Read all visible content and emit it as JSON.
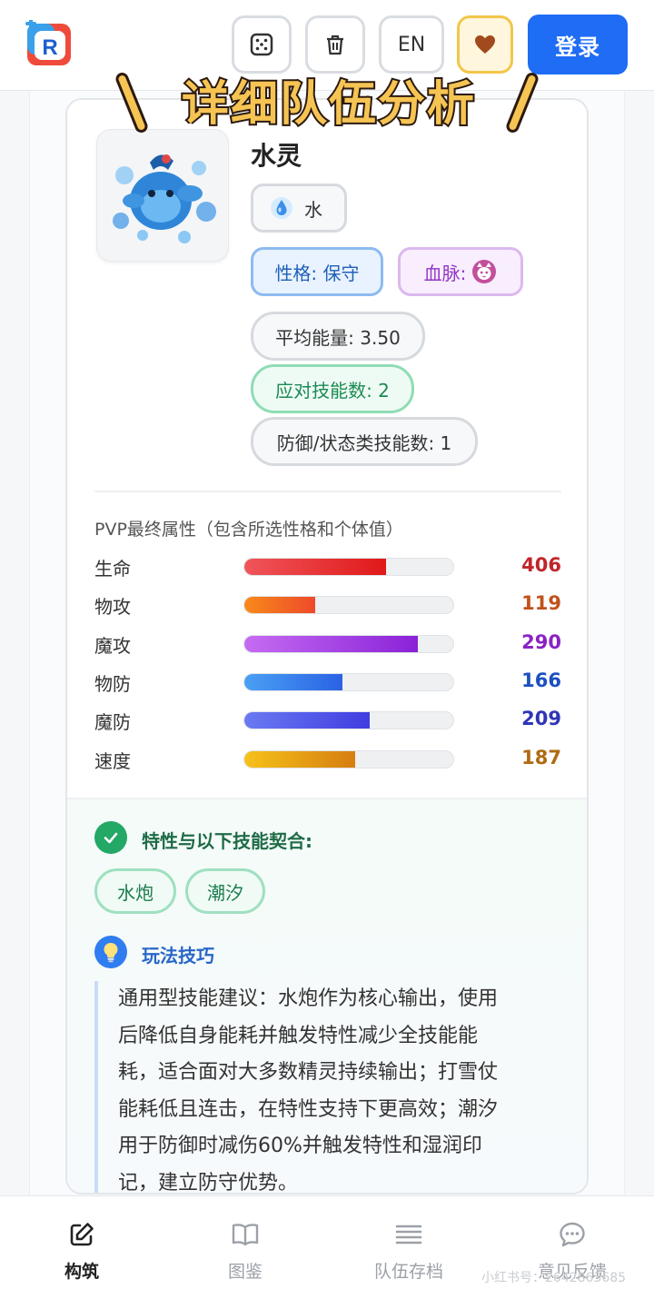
{
  "header": {
    "lang_label": "EN",
    "login_label": "登录",
    "icons": [
      "dice-icon",
      "trash-icon",
      "heart-icon"
    ]
  },
  "overlay": {
    "title": "详细队伍分析"
  },
  "pet": {
    "name": "水灵",
    "type_label": "水",
    "nature_label": "性格: 保守",
    "bloodline_label": "血脉:",
    "avg_energy": "平均能量: 3.50",
    "counter_skills": "应对技能数: 2",
    "defense_skills": "防御/状态类技能数: 1"
  },
  "stats": {
    "title": "PVP最终属性（包含所选性格和个体值）",
    "max_value": 430,
    "rows": [
      {
        "label": "生命",
        "value": "406",
        "fraction": 0.68,
        "color": "#c0262b",
        "grad": [
          "#f0555a",
          "#e01919"
        ]
      },
      {
        "label": "物攻",
        "value": "119",
        "fraction": 0.34,
        "color": "#c0521c",
        "grad": [
          "#f88a1a",
          "#ee4a2a"
        ]
      },
      {
        "label": "魔攻",
        "value": "290",
        "fraction": 0.83,
        "color": "#8a22c4",
        "grad": [
          "#c56cf2",
          "#8a22d8"
        ]
      },
      {
        "label": "物防",
        "value": "166",
        "fraction": 0.47,
        "color": "#1d4fc0",
        "grad": [
          "#4aa0f4",
          "#2a62e4"
        ]
      },
      {
        "label": "魔防",
        "value": "209",
        "fraction": 0.6,
        "color": "#3035b6",
        "grad": [
          "#6b7af2",
          "#3f3de0"
        ]
      },
      {
        "label": "速度",
        "value": "187",
        "fraction": 0.53,
        "color": "#b06a10",
        "grad": [
          "#f6c21a",
          "#d67e10"
        ]
      }
    ]
  },
  "synergy": {
    "title": "特性与以下技能契合:",
    "skills": [
      "水炮",
      "潮汐"
    ]
  },
  "tips": {
    "title": "玩法技巧",
    "lines": [
      "通用型技能建议：水炮作为核心输出，使用",
      "后降低自身能耗并触发特性减少全技能能",
      "耗，适合面对大多数精灵持续输出；打雪仗",
      "能耗低且连击，在特性支持下更高效；潮汐",
      "用于防御时减伤60%并触发特性和湿润印",
      "记，建立防守优势。"
    ]
  },
  "nav": {
    "items": [
      {
        "label": "构筑",
        "icon": "edit-icon",
        "active": true
      },
      {
        "label": "图鉴",
        "icon": "book-icon",
        "active": false
      },
      {
        "label": "队伍存档",
        "icon": "list-icon",
        "active": false
      },
      {
        "label": "意见反馈",
        "icon": "chat-icon",
        "active": false
      }
    ]
  },
  "watermark": "小红书号：2642863685"
}
